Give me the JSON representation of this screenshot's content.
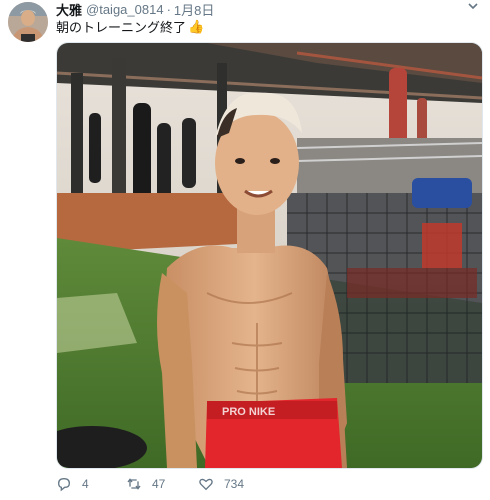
{
  "tweet": {
    "display_name": "大雅",
    "handle": "@taiga_0814",
    "separator": "·",
    "date": "1月8日",
    "text": "朝のトレーニング終了",
    "emoji": "👍"
  },
  "actions": {
    "reply_count": "4",
    "retweet_count": "47",
    "like_count": "734"
  },
  "media": {
    "waistband_text": "PRO NIKE"
  },
  "icons": {
    "reply": "reply-icon",
    "retweet": "retweet-icon",
    "like": "heart-icon",
    "caret": "chevron-down-icon"
  }
}
